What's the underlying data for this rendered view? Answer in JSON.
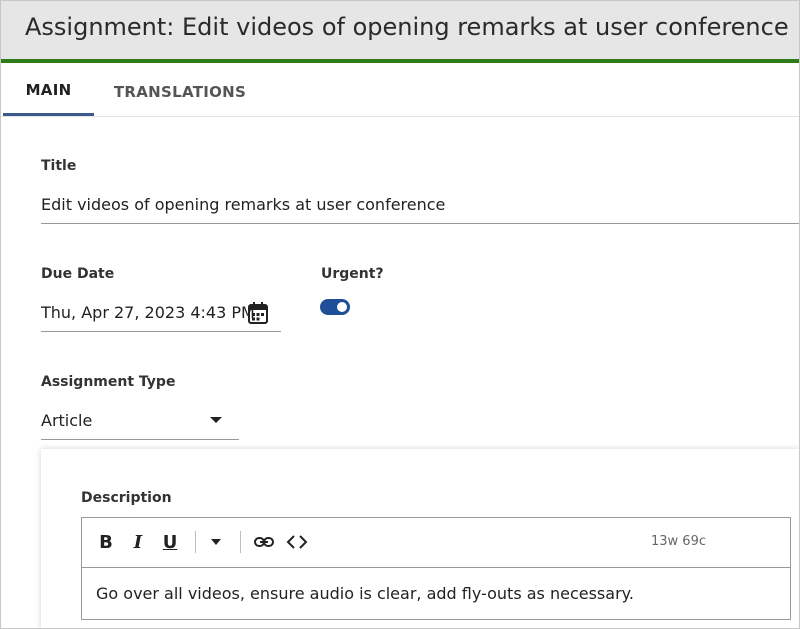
{
  "header": {
    "title": "Assignment: Edit videos of opening remarks at user conference"
  },
  "tabs": [
    {
      "label": "MAIN",
      "active": true
    },
    {
      "label": "TRANSLATIONS",
      "active": false
    }
  ],
  "form": {
    "title_label": "Title",
    "title_value": "Edit videos of opening remarks at user conference",
    "due_date_label": "Due Date",
    "due_date_value": "Thu, Apr 27, 2023 4:43 PM",
    "urgent_label": "Urgent?",
    "urgent_on": true,
    "assignment_type_label": "Assignment Type",
    "assignment_type_value": "Article",
    "description_label": "Description",
    "description_text": "Go over all videos, ensure audio is clear, add fly-outs as necessary.",
    "word_count": "13w 69c"
  },
  "toolbar": {
    "bold": "B",
    "italic": "I",
    "underline": "U"
  },
  "colors": {
    "accent_green": "#2e7d1a",
    "tab_underline": "#3a5a8c",
    "toggle_blue": "#1f4f96"
  },
  "icons": [
    "calendar-icon",
    "chevron-down-icon",
    "link-icon",
    "code-icon"
  ]
}
